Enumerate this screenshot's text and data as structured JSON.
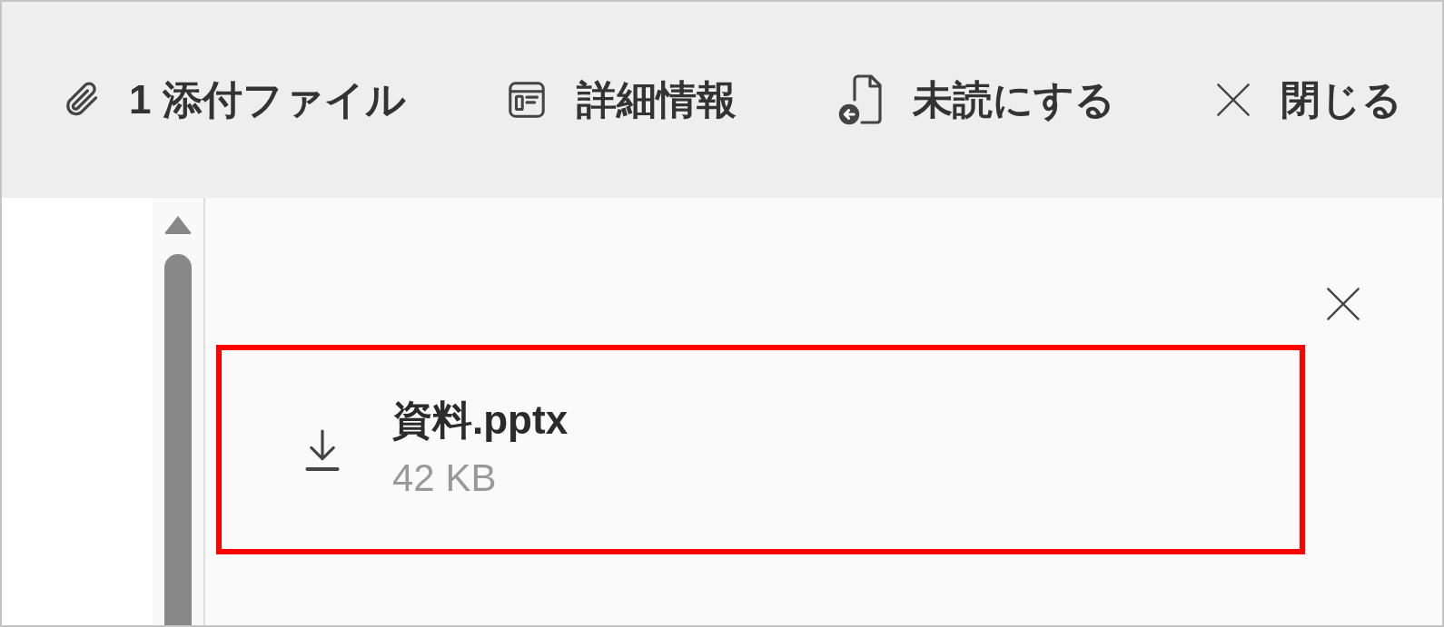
{
  "toolbar": {
    "buttons": [
      {
        "kind": "attach",
        "label": "1 添付ファイル"
      },
      {
        "kind": "details",
        "label": "詳細情報"
      },
      {
        "kind": "unread",
        "label": "未読にする"
      },
      {
        "kind": "close",
        "label": "閉じる"
      }
    ]
  },
  "attachment_pane": {
    "attachments": [
      {
        "name": "資料.pptx",
        "size": "42 KB",
        "highlighted": true
      }
    ]
  }
}
